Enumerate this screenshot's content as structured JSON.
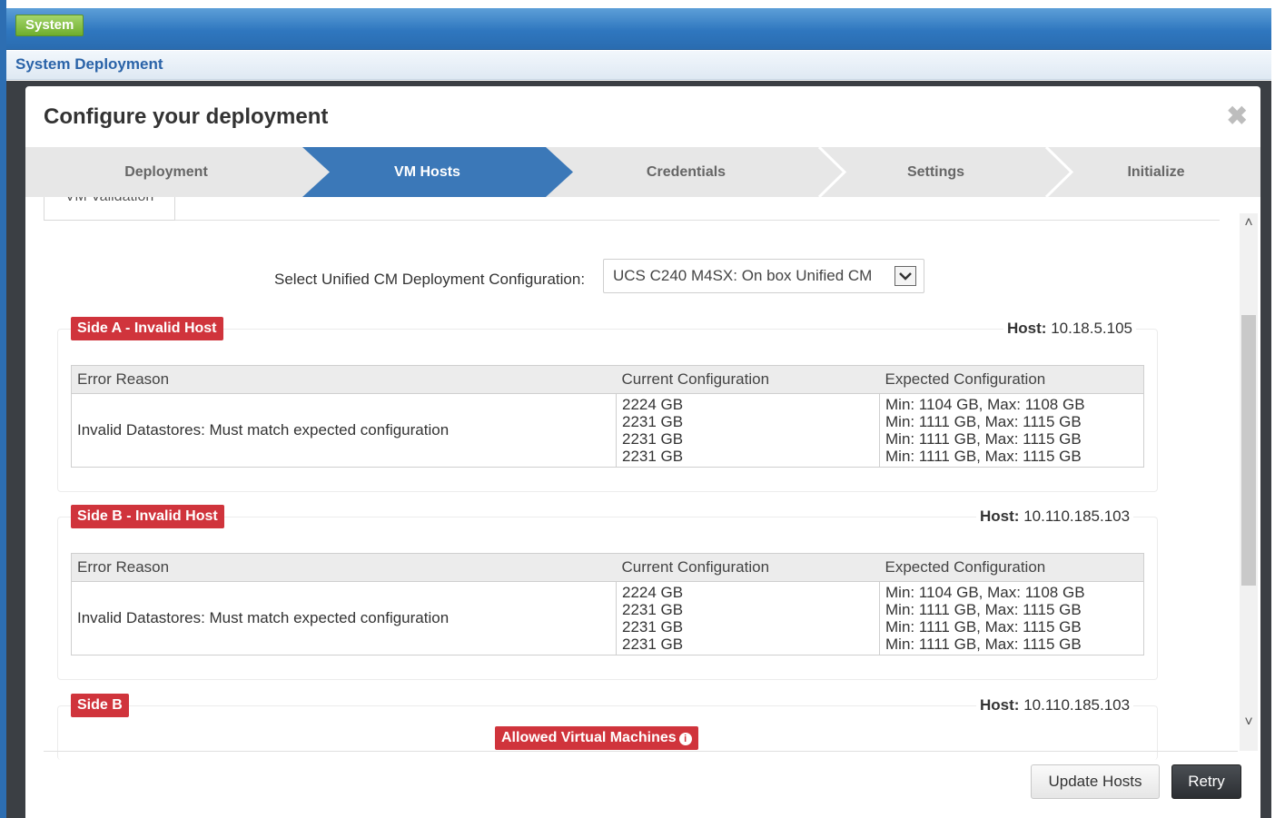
{
  "app": {
    "system_label": "System",
    "section_title": "System Deployment"
  },
  "modal": {
    "title": "Configure your deployment",
    "close_symbol": "✖"
  },
  "wizard": {
    "steps": [
      {
        "label": "Deployment",
        "state": "done"
      },
      {
        "label": "VM Hosts",
        "state": "active"
      },
      {
        "label": "Credentials",
        "state": "pending"
      },
      {
        "label": "Settings",
        "state": "pending"
      },
      {
        "label": "Initialize",
        "state": "pending"
      }
    ],
    "colors": {
      "active": "#3b78b8",
      "inactive": "#e7e7e7"
    }
  },
  "tab": {
    "label": "VM Validation"
  },
  "config": {
    "label": "Select Unified CM Deployment Configuration:",
    "value": "UCS C240 M4SX: On box Unified CM"
  },
  "hosts": [
    {
      "badge": "Side A - Invalid Host",
      "host_key": "Host:",
      "host_value": "10.18.5.105",
      "headers": [
        "Error Reason",
        "Current Configuration",
        "Expected Configuration"
      ],
      "reason": "Invalid Datastores: Must match expected configuration",
      "current": [
        "2224 GB",
        "2231 GB",
        "2231 GB",
        "2231 GB"
      ],
      "expected": [
        "Min: 1104 GB, Max: 1108 GB",
        "Min: 1111 GB, Max: 1115 GB",
        "Min: 1111 GB, Max: 1115 GB",
        "Min: 1111 GB, Max: 1115 GB"
      ]
    },
    {
      "badge": "Side B - Invalid Host",
      "host_key": "Host:",
      "host_value": "10.110.185.103",
      "headers": [
        "Error Reason",
        "Current Configuration",
        "Expected Configuration"
      ],
      "reason": "Invalid Datastores: Must match expected configuration",
      "current": [
        "2224 GB",
        "2231 GB",
        "2231 GB",
        "2231 GB"
      ],
      "expected": [
        "Min: 1104 GB, Max: 1108 GB",
        "Min: 1111 GB, Max: 1115 GB",
        "Min: 1111 GB, Max: 1115 GB",
        "Min: 1111 GB, Max: 1115 GB"
      ]
    },
    {
      "badge": "Side B",
      "host_key": "Host:",
      "host_value": "10.110.185.103"
    }
  ],
  "allowed_vms": {
    "label": "Allowed Virtual Machines",
    "info_symbol": "i"
  },
  "buttons": {
    "update_hosts": "Update Hosts",
    "retry": "Retry"
  },
  "colors": {
    "error_badge": "#d0343c",
    "topbar": "#2f77bf",
    "system_badge": "#6fae2d"
  }
}
